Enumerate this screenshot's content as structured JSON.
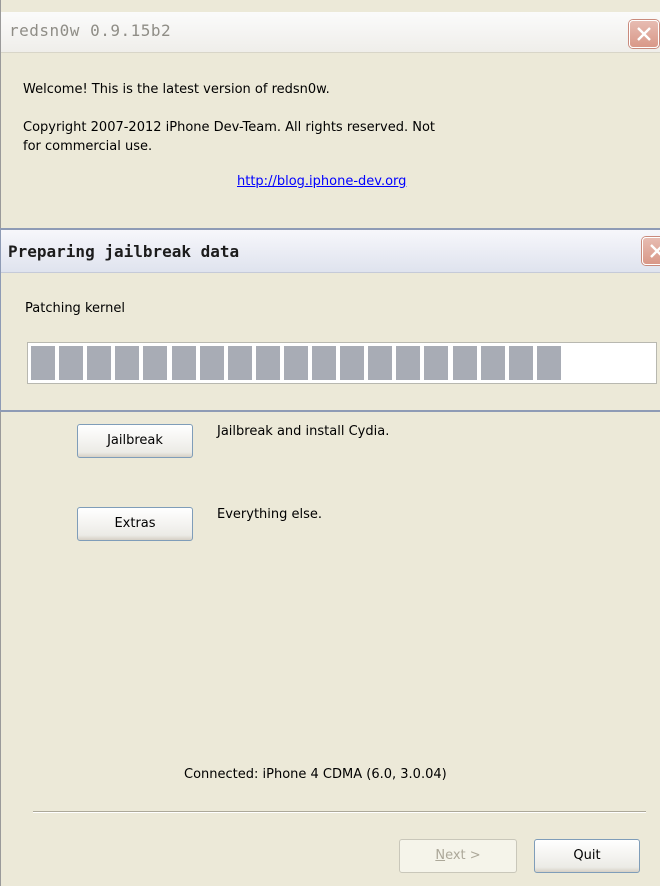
{
  "main_window": {
    "title": "redsn0w 0.9.15b2",
    "welcome": "Welcome!  This is the latest version of redsn0w.",
    "copyright_line1": "Copyright 2007-2012 iPhone Dev-Team. All rights reserved. Not",
    "copyright_line2": "for commercial use.",
    "link": "http://blog.iphone-dev.org",
    "jailbreak_button": "Jailbreak",
    "jailbreak_desc": "Jailbreak and install Cydia.",
    "extras_button": "Extras",
    "extras_desc": "Everything else.",
    "connected": "Connected: iPhone 4 CDMA (6.0, 3.0.04)",
    "next_button_mnemonic": "N",
    "next_button_rest": "ext >",
    "quit_button": "Quit"
  },
  "progress_dialog": {
    "title": "Preparing jailbreak data",
    "status": "Patching kernel",
    "progress_segments_filled": 19,
    "progress_fraction": 0.85
  },
  "colors": {
    "window_bg": "#ece9d8",
    "link": "#0000ff",
    "progress_segment": "#a8acb5",
    "close_button": "#d99888"
  },
  "icons": {
    "close": "close-x-icon"
  }
}
